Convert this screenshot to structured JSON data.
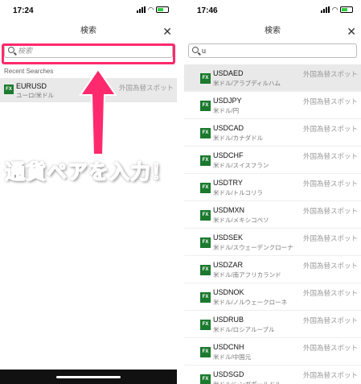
{
  "left": {
    "status": {
      "time": "17:24"
    },
    "title": "検索",
    "close": "✕",
    "search": {
      "placeholder": "検索"
    },
    "recent_label": "Recent Searches",
    "items": [
      {
        "fx": "FX",
        "symbol": "EURUSD",
        "name": "ユーロ/米ドル",
        "category": "外国為替スポット"
      }
    ],
    "annotation": {
      "text": "通貨ペアを入力！",
      "color": "#ff2a6d"
    }
  },
  "right": {
    "status": {
      "time": "17:46"
    },
    "title": "検索",
    "close": "✕",
    "search": {
      "value": "u"
    },
    "items": [
      {
        "fx": "FX",
        "symbol": "USDAED",
        "name": "米ドル/アラブディルハム",
        "category": "外国為替スポット"
      },
      {
        "fx": "FX",
        "symbol": "USDJPY",
        "name": "米ドル/円",
        "category": "外国為替スポット"
      },
      {
        "fx": "FX",
        "symbol": "USDCAD",
        "name": "米ドル/カナダドル",
        "category": "外国為替スポット"
      },
      {
        "fx": "FX",
        "symbol": "USDCHF",
        "name": "米ドル/スイスフラン",
        "category": "外国為替スポット"
      },
      {
        "fx": "FX",
        "symbol": "USDTRY",
        "name": "米ドル/トルコリラ",
        "category": "外国為替スポット"
      },
      {
        "fx": "FX",
        "symbol": "USDMXN",
        "name": "米ドル/メキシコペソ",
        "category": "外国為替スポット"
      },
      {
        "fx": "FX",
        "symbol": "USDSEK",
        "name": "米ドル/スウェーデンクローナ",
        "category": "外国為替スポット"
      },
      {
        "fx": "FX",
        "symbol": "USDZAR",
        "name": "米ドル/南アフリカランド",
        "category": "外国為替スポット"
      },
      {
        "fx": "FX",
        "symbol": "USDNOK",
        "name": "米ドル/ノルウェークローネ",
        "category": "外国為替スポット"
      },
      {
        "fx": "FX",
        "symbol": "USDRUB",
        "name": "米ドル/ロシアルーブル",
        "category": "外国為替スポット"
      },
      {
        "fx": "FX",
        "symbol": "USDCNH",
        "name": "米ドル/中国元",
        "category": "外国為替スポット"
      },
      {
        "fx": "FX",
        "symbol": "USDSGD",
        "name": "米ドル/シンガポールドル",
        "category": "外国為替スポット"
      }
    ]
  },
  "colors": {
    "fx_badge": "#1b7a2e",
    "highlight": "#ff2a6d",
    "selected_row": "#e9e9e9"
  }
}
